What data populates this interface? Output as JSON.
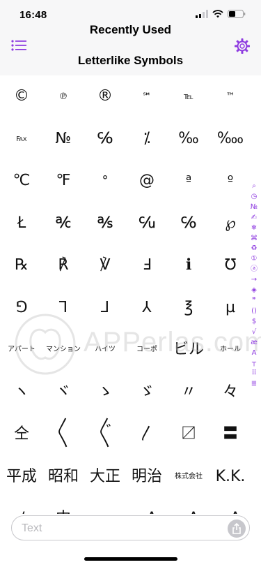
{
  "status": {
    "time": "16:48"
  },
  "header": {
    "title": "Recently Used",
    "subtitle": "Letterlike Symbols"
  },
  "accent_color": "#8e3be0",
  "symbols": [
    "©",
    "℗",
    "®",
    "℠",
    "℡",
    "™",
    "℻",
    "№",
    "℅",
    "⁒",
    "‰",
    "‱",
    "℃",
    "℉",
    "°",
    "@",
    "ª",
    "º",
    "Ł",
    "℀",
    "℁",
    "℆",
    "℅",
    "℘",
    "℞",
    "℟",
    "℣",
    "Ⅎ",
    "ℹ",
    "℧",
    "⅁",
    "⅂",
    "⅃",
    "⅄",
    "℥",
    "µ",
    "アパート",
    "マンション",
    "ハイツ",
    "コーポ",
    "ビル",
    "ホール",
    "ヽ",
    "ヾ",
    "ゝ",
    "ゞ",
    "〃",
    "々",
    "仝",
    "〱",
    "〲",
    "〳",
    "〼",
    "〓",
    "平成",
    "昭和",
    "大正",
    "明治",
    "株式会社",
    "K.K.",
    "a/c",
    "中",
    "〜",
    "pA",
    "nA",
    "μA"
  ],
  "index_bar": [
    "⌕",
    "◷",
    "№",
    "✍",
    "❄",
    "⌘",
    "♻",
    "①",
    "ⓐ",
    "→",
    "◈",
    "❞",
    "()",
    "$",
    "√",
    "æ",
    "A",
    "┬",
    "⠿",
    "≣"
  ],
  "input": {
    "placeholder": "Text",
    "value": ""
  },
  "watermark": "APPerlas.com"
}
